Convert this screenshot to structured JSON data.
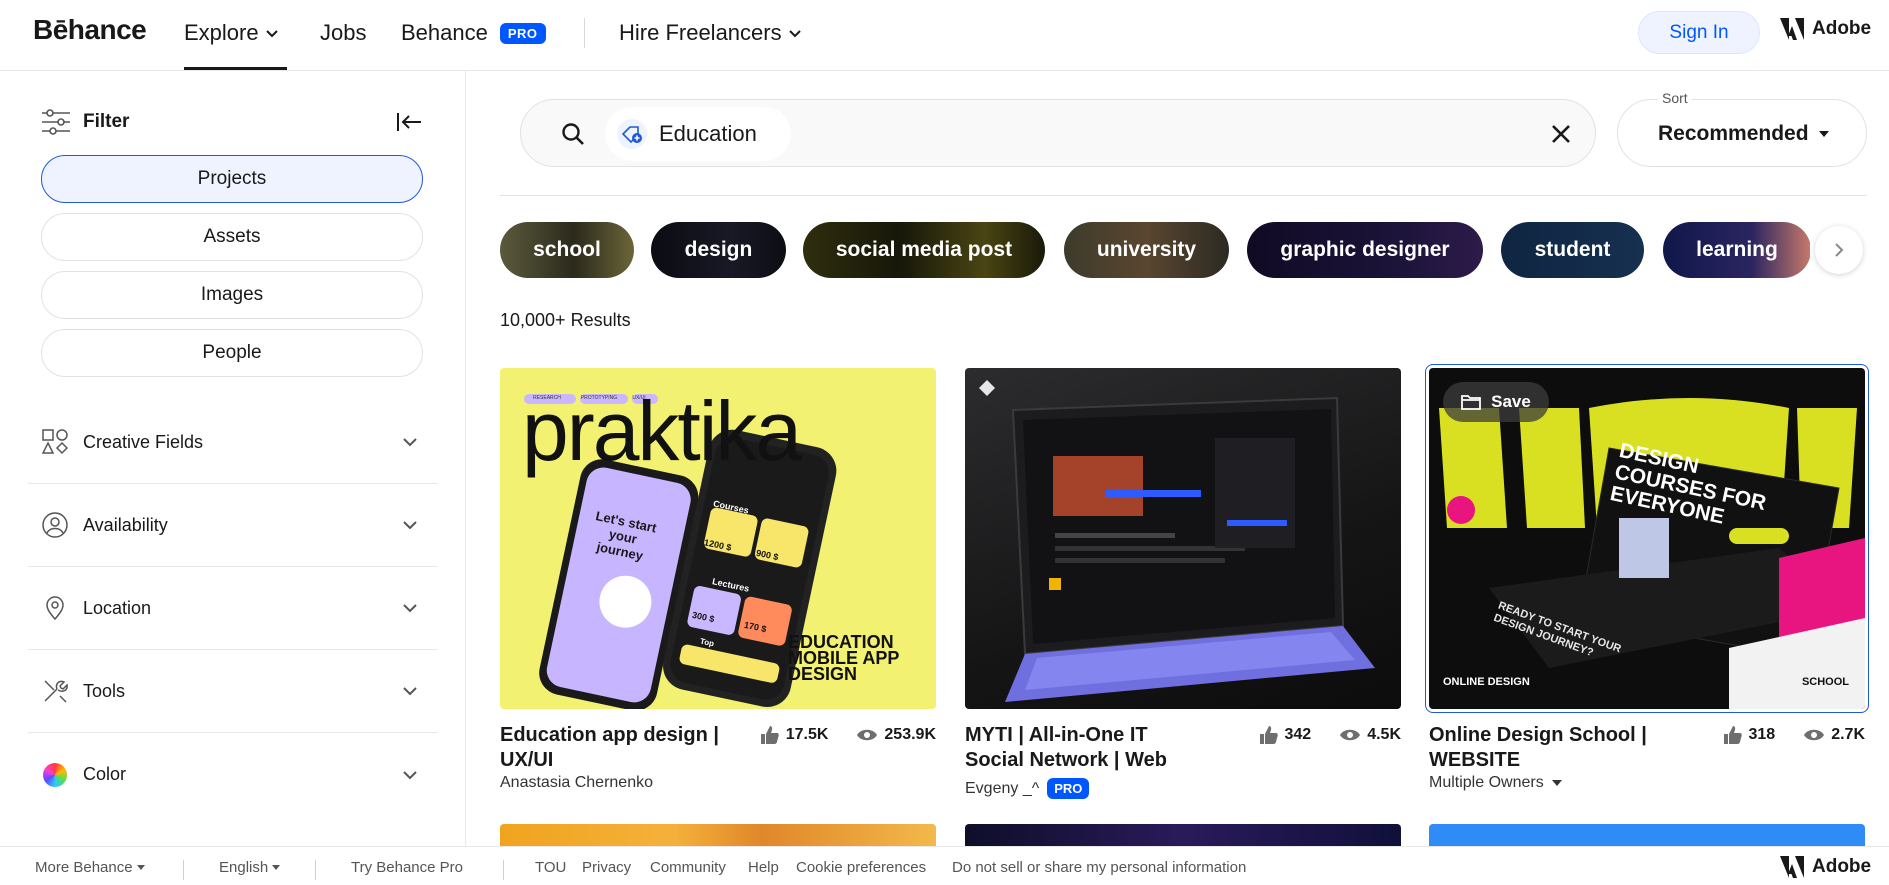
{
  "header": {
    "logo": "Bēhance",
    "nav": {
      "explore": "Explore",
      "jobs": "Jobs",
      "behance": "Behance",
      "pro": "PRO",
      "hire": "Hire Freelancers"
    },
    "sign_in": "Sign In",
    "adobe": "Adobe"
  },
  "sidebar": {
    "filter_label": "Filter",
    "segments": [
      "Projects",
      "Assets",
      "Images",
      "People"
    ],
    "active_segment": "Projects",
    "accordions": [
      "Creative Fields",
      "Availability",
      "Location",
      "Tools",
      "Color"
    ]
  },
  "search": {
    "query": "Education",
    "sort_label": "Sort",
    "sort_value": "Recommended"
  },
  "tags": [
    "school",
    "design",
    "social media post",
    "university",
    "graphic designer",
    "student",
    "learning"
  ],
  "results_count": "10,000+ Results",
  "cards": [
    {
      "title": "Education app design | UX/UI",
      "owner": "Anastasia Chernenko",
      "likes": "17.5K",
      "views": "253.9K",
      "thumb": {
        "chips": [
          "RESEARCH",
          "PROTOTYPING",
          "UX/UI"
        ],
        "brand": "praktika",
        "phone_text": "Let's start your journey",
        "courses_label": "Courses",
        "lectures_label": "Lectures",
        "top_label": "Top",
        "price1": "1200 $",
        "price2": "900 $",
        "price3": "300 $",
        "price4": "170 $",
        "caption_lines": [
          "EDUCATION",
          "MOBILE APP",
          "DESIGN"
        ]
      }
    },
    {
      "title": "MYTI | All-in-One IT Social Network | Web",
      "owner": "Evgeny _^",
      "owner_badge": "PRO",
      "likes": "342",
      "views": "4.5K"
    },
    {
      "title": "Online Design School | WEBSITE",
      "owner": "Multiple Owners",
      "likes": "318",
      "views": "2.7K",
      "save_label": "Save",
      "thumb": {
        "headline": "DESIGN COURSES FOR EVERYONE",
        "ready": "READY TO START YOUR DESIGN JOURNEY?",
        "brand_left": "ONLINE DESIGN",
        "brand_right": "SCHOOL"
      }
    }
  ],
  "footer": {
    "more": "More Behance",
    "language": "English",
    "try_pro": "Try Behance Pro",
    "links": [
      "TOU",
      "Privacy",
      "Community",
      "Help",
      "Cookie preferences",
      "Do not sell or share my personal information"
    ],
    "adobe": "Adobe"
  },
  "colors": {
    "accent": "#0057ff",
    "card1_bg": "#f3f171",
    "card2_bg": "#161616",
    "card3_bg": "#0d0d0d",
    "card3_accent": "#d9e021",
    "card3_pink": "#e8147f"
  }
}
